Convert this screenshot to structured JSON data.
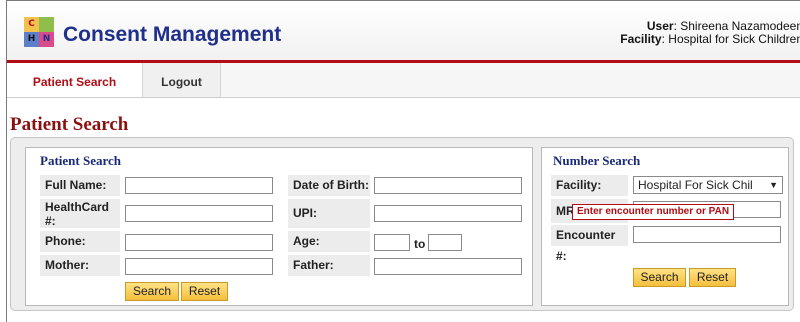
{
  "header": {
    "app_title": "Consent Management",
    "user_label": "User",
    "user_name": "Shireena Nazamodeen",
    "facility_label": "Facility",
    "facility_name": "Hospital for Sick Children",
    "logo_letters": [
      "C",
      "H",
      "N"
    ]
  },
  "nav": {
    "tabs": [
      {
        "label": "Patient Search",
        "active": true
      },
      {
        "label": "Logout",
        "active": false
      }
    ]
  },
  "page_title": "Patient Search",
  "patient_search": {
    "legend": "Patient Search",
    "full_name_label": "Full Name:",
    "healthcard_label": "HealthCard #:",
    "phone_label": "Phone:",
    "mother_label": "Mother:",
    "dob_label": "Date of Birth:",
    "upi_label": "UPI:",
    "age_label": "Age:",
    "age_to_label": "to",
    "father_label": "Father:",
    "search_button": "Search",
    "reset_button": "Reset"
  },
  "number_search": {
    "legend": "Number Search",
    "facility_label": "Facility:",
    "facility_value": "Hospital For Sick Chil",
    "mrn_label": "MR",
    "encounter_label": "Encounter #:",
    "tooltip": "Enter encounter number or PAN",
    "search_button": "Search",
    "reset_button": "Reset"
  },
  "colors": {
    "brand_blue": "#1f2f8a",
    "brand_red": "#b00d14",
    "button_gold": "#f6bf3d"
  }
}
